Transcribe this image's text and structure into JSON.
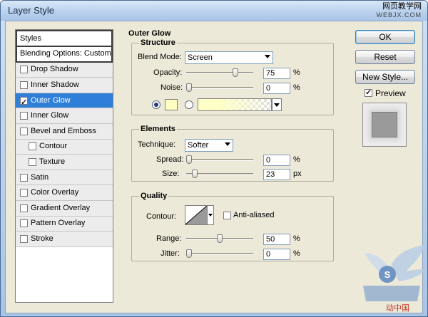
{
  "window": {
    "title": "Layer Style",
    "watermark_top_cn": "网页教学网",
    "watermark_top_url": "WEBJX.COM",
    "watermark_bottom_text": "动中国"
  },
  "styles_list": {
    "header": "Styles",
    "blending_options": "Blending Options: Custom",
    "items": [
      {
        "label": "Drop Shadow",
        "checked": false,
        "indent": false,
        "selected": false
      },
      {
        "label": "Inner Shadow",
        "checked": false,
        "indent": false,
        "selected": false
      },
      {
        "label": "Outer Glow",
        "checked": true,
        "indent": false,
        "selected": true
      },
      {
        "label": "Inner Glow",
        "checked": false,
        "indent": false,
        "selected": false
      },
      {
        "label": "Bevel and Emboss",
        "checked": false,
        "indent": false,
        "selected": false
      },
      {
        "label": "Contour",
        "checked": false,
        "indent": true,
        "selected": false
      },
      {
        "label": "Texture",
        "checked": false,
        "indent": true,
        "selected": false
      },
      {
        "label": "Satin",
        "checked": false,
        "indent": false,
        "selected": false
      },
      {
        "label": "Color Overlay",
        "checked": false,
        "indent": false,
        "selected": false
      },
      {
        "label": "Gradient Overlay",
        "checked": false,
        "indent": false,
        "selected": false
      },
      {
        "label": "Pattern Overlay",
        "checked": false,
        "indent": false,
        "selected": false
      },
      {
        "label": "Stroke",
        "checked": false,
        "indent": false,
        "selected": false
      }
    ]
  },
  "outer_glow": {
    "title": "Outer Glow",
    "structure": {
      "label": "Structure",
      "blend_mode_label": "Blend Mode:",
      "blend_mode_value": "Screen",
      "opacity_label": "Opacity:",
      "opacity_value": "75",
      "opacity_unit": "%",
      "opacity_level": 0.75,
      "noise_label": "Noise:",
      "noise_value": "0",
      "noise_unit": "%",
      "noise_level": 0,
      "glow_color": "#ffffc0",
      "color_mode": "solid"
    },
    "elements": {
      "label": "Elements",
      "technique_label": "Technique:",
      "technique_value": "Softer",
      "spread_label": "Spread:",
      "spread_value": "0",
      "spread_unit": "%",
      "spread_level": 0,
      "size_label": "Size:",
      "size_value": "23",
      "size_unit": "px",
      "size_level": 0.092
    },
    "quality": {
      "label": "Quality",
      "contour_label": "Contour:",
      "anti_aliased_label": "Anti-aliased",
      "anti_aliased_checked": false,
      "range_label": "Range:",
      "range_value": "50",
      "range_unit": "%",
      "range_level": 0.5,
      "jitter_label": "Jitter:",
      "jitter_value": "0",
      "jitter_unit": "%",
      "jitter_level": 0
    }
  },
  "buttons": {
    "ok": "OK",
    "reset": "Reset",
    "new_style": "New Style...",
    "preview_label": "Preview",
    "preview_checked": true
  },
  "colors": {
    "selected_bg": "#2f7fd9",
    "dialog_bg": "#ece9d8"
  }
}
